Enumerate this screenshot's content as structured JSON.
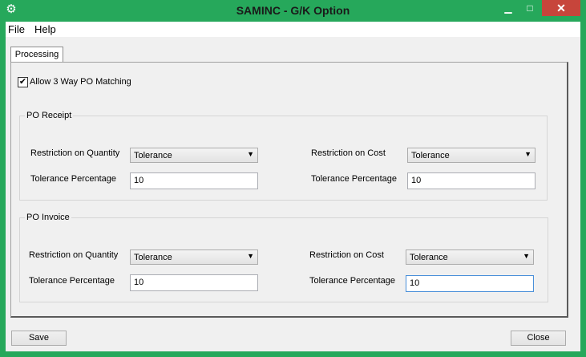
{
  "window": {
    "title": "SAMINC - G/K Option",
    "app_icon": "gear-icon",
    "controls": {
      "minimize": "▁",
      "maximize": "□",
      "close": "✕"
    }
  },
  "menu": {
    "file": "File",
    "help": "Help"
  },
  "tabs": [
    {
      "label": "Processing"
    }
  ],
  "processing": {
    "allow_3way": {
      "label": "Allow 3 Way PO Matching",
      "checked": true,
      "mark": "✔"
    },
    "po_receipt": {
      "title": "PO Receipt",
      "qty_label": "Restriction on Quantity",
      "qty_value": "Tolerance",
      "qty_tol_label": "Tolerance Percentage",
      "qty_tol_value": "10",
      "cost_label": "Restriction on Cost",
      "cost_value": "Tolerance",
      "cost_tol_label": "Tolerance Percentage",
      "cost_tol_value": "10"
    },
    "po_invoice": {
      "title": "PO Invoice",
      "qty_label": "Restriction on Quantity",
      "qty_value": "Tolerance",
      "qty_tol_label": "Tolerance Percentage",
      "qty_tol_value": "10",
      "cost_label": "Restriction on Cost",
      "cost_value": "Tolerance",
      "cost_tol_label": "Tolerance Percentage",
      "cost_tol_value": "10"
    }
  },
  "buttons": {
    "save": "Save",
    "close": "Close"
  },
  "colors": {
    "titlebar": "#26a85b",
    "close_button": "#c7453b",
    "dialog_bg": "#f0f0f0"
  }
}
